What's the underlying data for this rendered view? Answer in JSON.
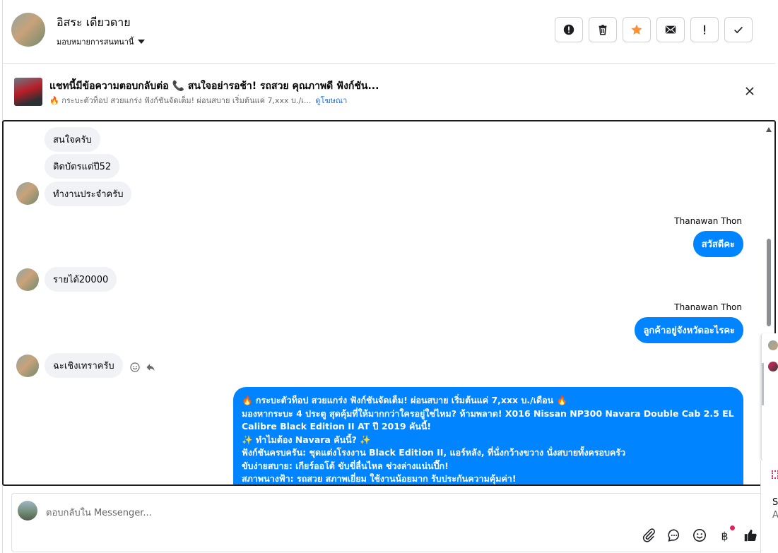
{
  "header": {
    "name": "อิสระ เดียวดาย",
    "assign_label": "มอบหมายการสนทนานี้",
    "toolbar": [
      {
        "name": "mark-spam-button",
        "icon": "alert-circle-icon"
      },
      {
        "name": "delete-button",
        "icon": "trash-icon"
      },
      {
        "name": "star-button",
        "icon": "star-icon"
      },
      {
        "name": "mark-unread-button",
        "icon": "envelope-icon"
      },
      {
        "name": "follow-up-button",
        "icon": "exclamation-icon"
      },
      {
        "name": "mark-done-button",
        "icon": "check-icon"
      }
    ],
    "star_color": "#f7923a"
  },
  "banner": {
    "title": "แชทนี้มีข้อความตอบกลับต่อ 📞 สนใจอย่ารอช้า! รถสวย คุณภาพดี ฟังก์ชัน...",
    "subtitle": "🔥 กระบะตัวท็อป สวยแกร่ง ฟังก์ชันจัดเต็ม! ผ่อนสบาย เริ่มต้นแค่ 7,xxx บ./เ...",
    "link": "ดูโฆษณา"
  },
  "chat": {
    "incoming": [
      {
        "text": "สนใจครับ"
      },
      {
        "text": "ติดบัตรแต่ปี52"
      },
      {
        "text": "ทำงานประจำครับ"
      },
      {
        "text": "รายได้20000"
      },
      {
        "text": "ฉะเชิงเทราครับ"
      }
    ],
    "outgoing": [
      {
        "sender": "Thanawan Thon",
        "text": "สวัสดีคะ"
      },
      {
        "sender": "Thanawan Thon",
        "text": "ลูกค้าอยู่จังหวัดอะไรคะ"
      }
    ],
    "ad_message_lines": [
      "🔥 กระบะตัวท็อป สวยแกร่ง ฟังก์ชันจัดเต็ม! ผ่อนสบาย เริ่มต้นแค่ 7,xxx บ./เดือน 🔥",
      "มองหากระบะ 4 ประตู สุดคุ้มที่ให้มากกว่าใครอยู่ใช่ไหม? ห้ามพลาด! X016 Nissan NP300 Navara Double Cab 2.5 EL",
      "Calibre Black Edition II AT ปี 2019 คันนี้!",
      "✨ ทำไมต้อง Navara คันนี้? ✨",
      "ฟังก์ชันครบครัน: ชุดแต่งโรงงาน Black Edition II, แอร์หลัง, ที่นั่งกว้างขวาง นั่งสบายทั้งครอบครัว",
      "ขับง่ายสบาย: เกียร์ออโต้ ขับขี่ลื่นไหล ช่วงล่างแน่นปึ๊ก!",
      "สภาพนางฟ้า: รถสวย สภาพเยี่ยม ใช้งานน้อยมาก รับประกันความคุ้มค่า!"
    ],
    "outgoing_color": "#0084ff",
    "incoming_color": "#f0f2f5"
  },
  "composer": {
    "placeholder": "ตอบกลับใน Messenger...",
    "actions": [
      "paperclip-icon",
      "chat-bubble-icon",
      "emoji-icon",
      "baht-icon",
      "thumbs-up-icon"
    ]
  },
  "side": {
    "t1": "Sc",
    "t2": "A"
  }
}
